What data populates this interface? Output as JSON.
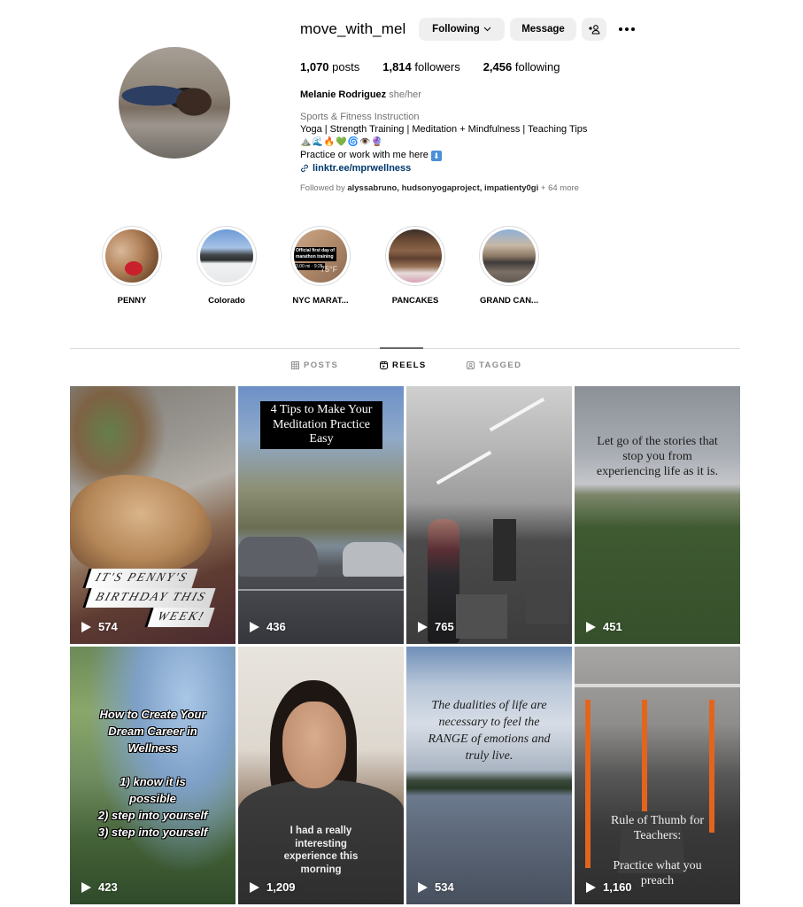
{
  "profile": {
    "username": "move_with_mel",
    "buttons": {
      "following": "Following",
      "message": "Message",
      "suggest_icon": "add-person-icon",
      "more_icon": "more-options-icon"
    },
    "stats": {
      "posts_count": "1,070",
      "posts_label": " posts",
      "followers_count": "1,814",
      "followers_label": " followers",
      "following_count": "2,456",
      "following_label": " following"
    },
    "bio": {
      "name": "Melanie Rodriguez",
      "pronouns": "she/her",
      "category": "Sports & Fitness Instruction",
      "line1": "Yoga | Strength Training | Meditation + Mindfulness | Teaching Tips",
      "emojis": "⛰️🌊🔥💚🌀👁️🔮",
      "line2": "Practice or work with me here",
      "line2_icon": "⬇",
      "link": "linktr.ee/mprwellness",
      "followed_by_prefix": "Followed by ",
      "followed_by_users": "alyssabruno, hudsonyogaproject, impatienty0gi",
      "followed_by_more": " + 64 more"
    }
  },
  "highlights": [
    {
      "label": "PENNY"
    },
    {
      "label": "Colorado"
    },
    {
      "label": "NYC MARAT...",
      "overlay_line1": "Official first day of",
      "overlay_line2": "marathon training",
      "overlay_stats": "3.00 mi · 9:25",
      "overlay_temp": "75°F"
    },
    {
      "label": "PANCAKES"
    },
    {
      "label": "GRAND CAN..."
    }
  ],
  "tabs": [
    {
      "label": "POSTS",
      "icon": "grid-icon",
      "active": false
    },
    {
      "label": "REELS",
      "icon": "reels-icon",
      "active": true
    },
    {
      "label": "TAGGED",
      "icon": "tagged-icon",
      "active": false
    }
  ],
  "reels": [
    {
      "views": "574",
      "caption": [
        "IT'S PENNY'S",
        "BIRTHDAY THIS",
        "WEEK!"
      ]
    },
    {
      "views": "436",
      "caption": [
        "4 Tips to Make Your",
        "Meditation Practice",
        "Easy"
      ]
    },
    {
      "views": "765",
      "caption": []
    },
    {
      "views": "451",
      "caption": [
        "Let go of the stories that",
        "stop you from",
        "experiencing life as it is."
      ]
    },
    {
      "views": "423",
      "caption": [
        "How to Create Your",
        "Dream Career in",
        "Wellness",
        "",
        "1) know it is",
        "possible",
        "2) step into yourself",
        "3) step into yourself"
      ]
    },
    {
      "views": "1,209",
      "caption": [
        "I had a really",
        "interesting",
        "experience this",
        "morning"
      ]
    },
    {
      "views": "534",
      "caption": [
        "The dualities of life are",
        "necessary to feel the",
        "RANGE of emotions and",
        "truly live."
      ]
    },
    {
      "views": "1,160",
      "caption": [
        "Rule of Thumb for",
        "Teachers:",
        "",
        "Practice what you",
        "preach"
      ]
    }
  ],
  "colors": {
    "link": "#00376b",
    "secondary_text": "#737373",
    "button_bg": "#efefef",
    "divider": "#dbdbdb"
  }
}
